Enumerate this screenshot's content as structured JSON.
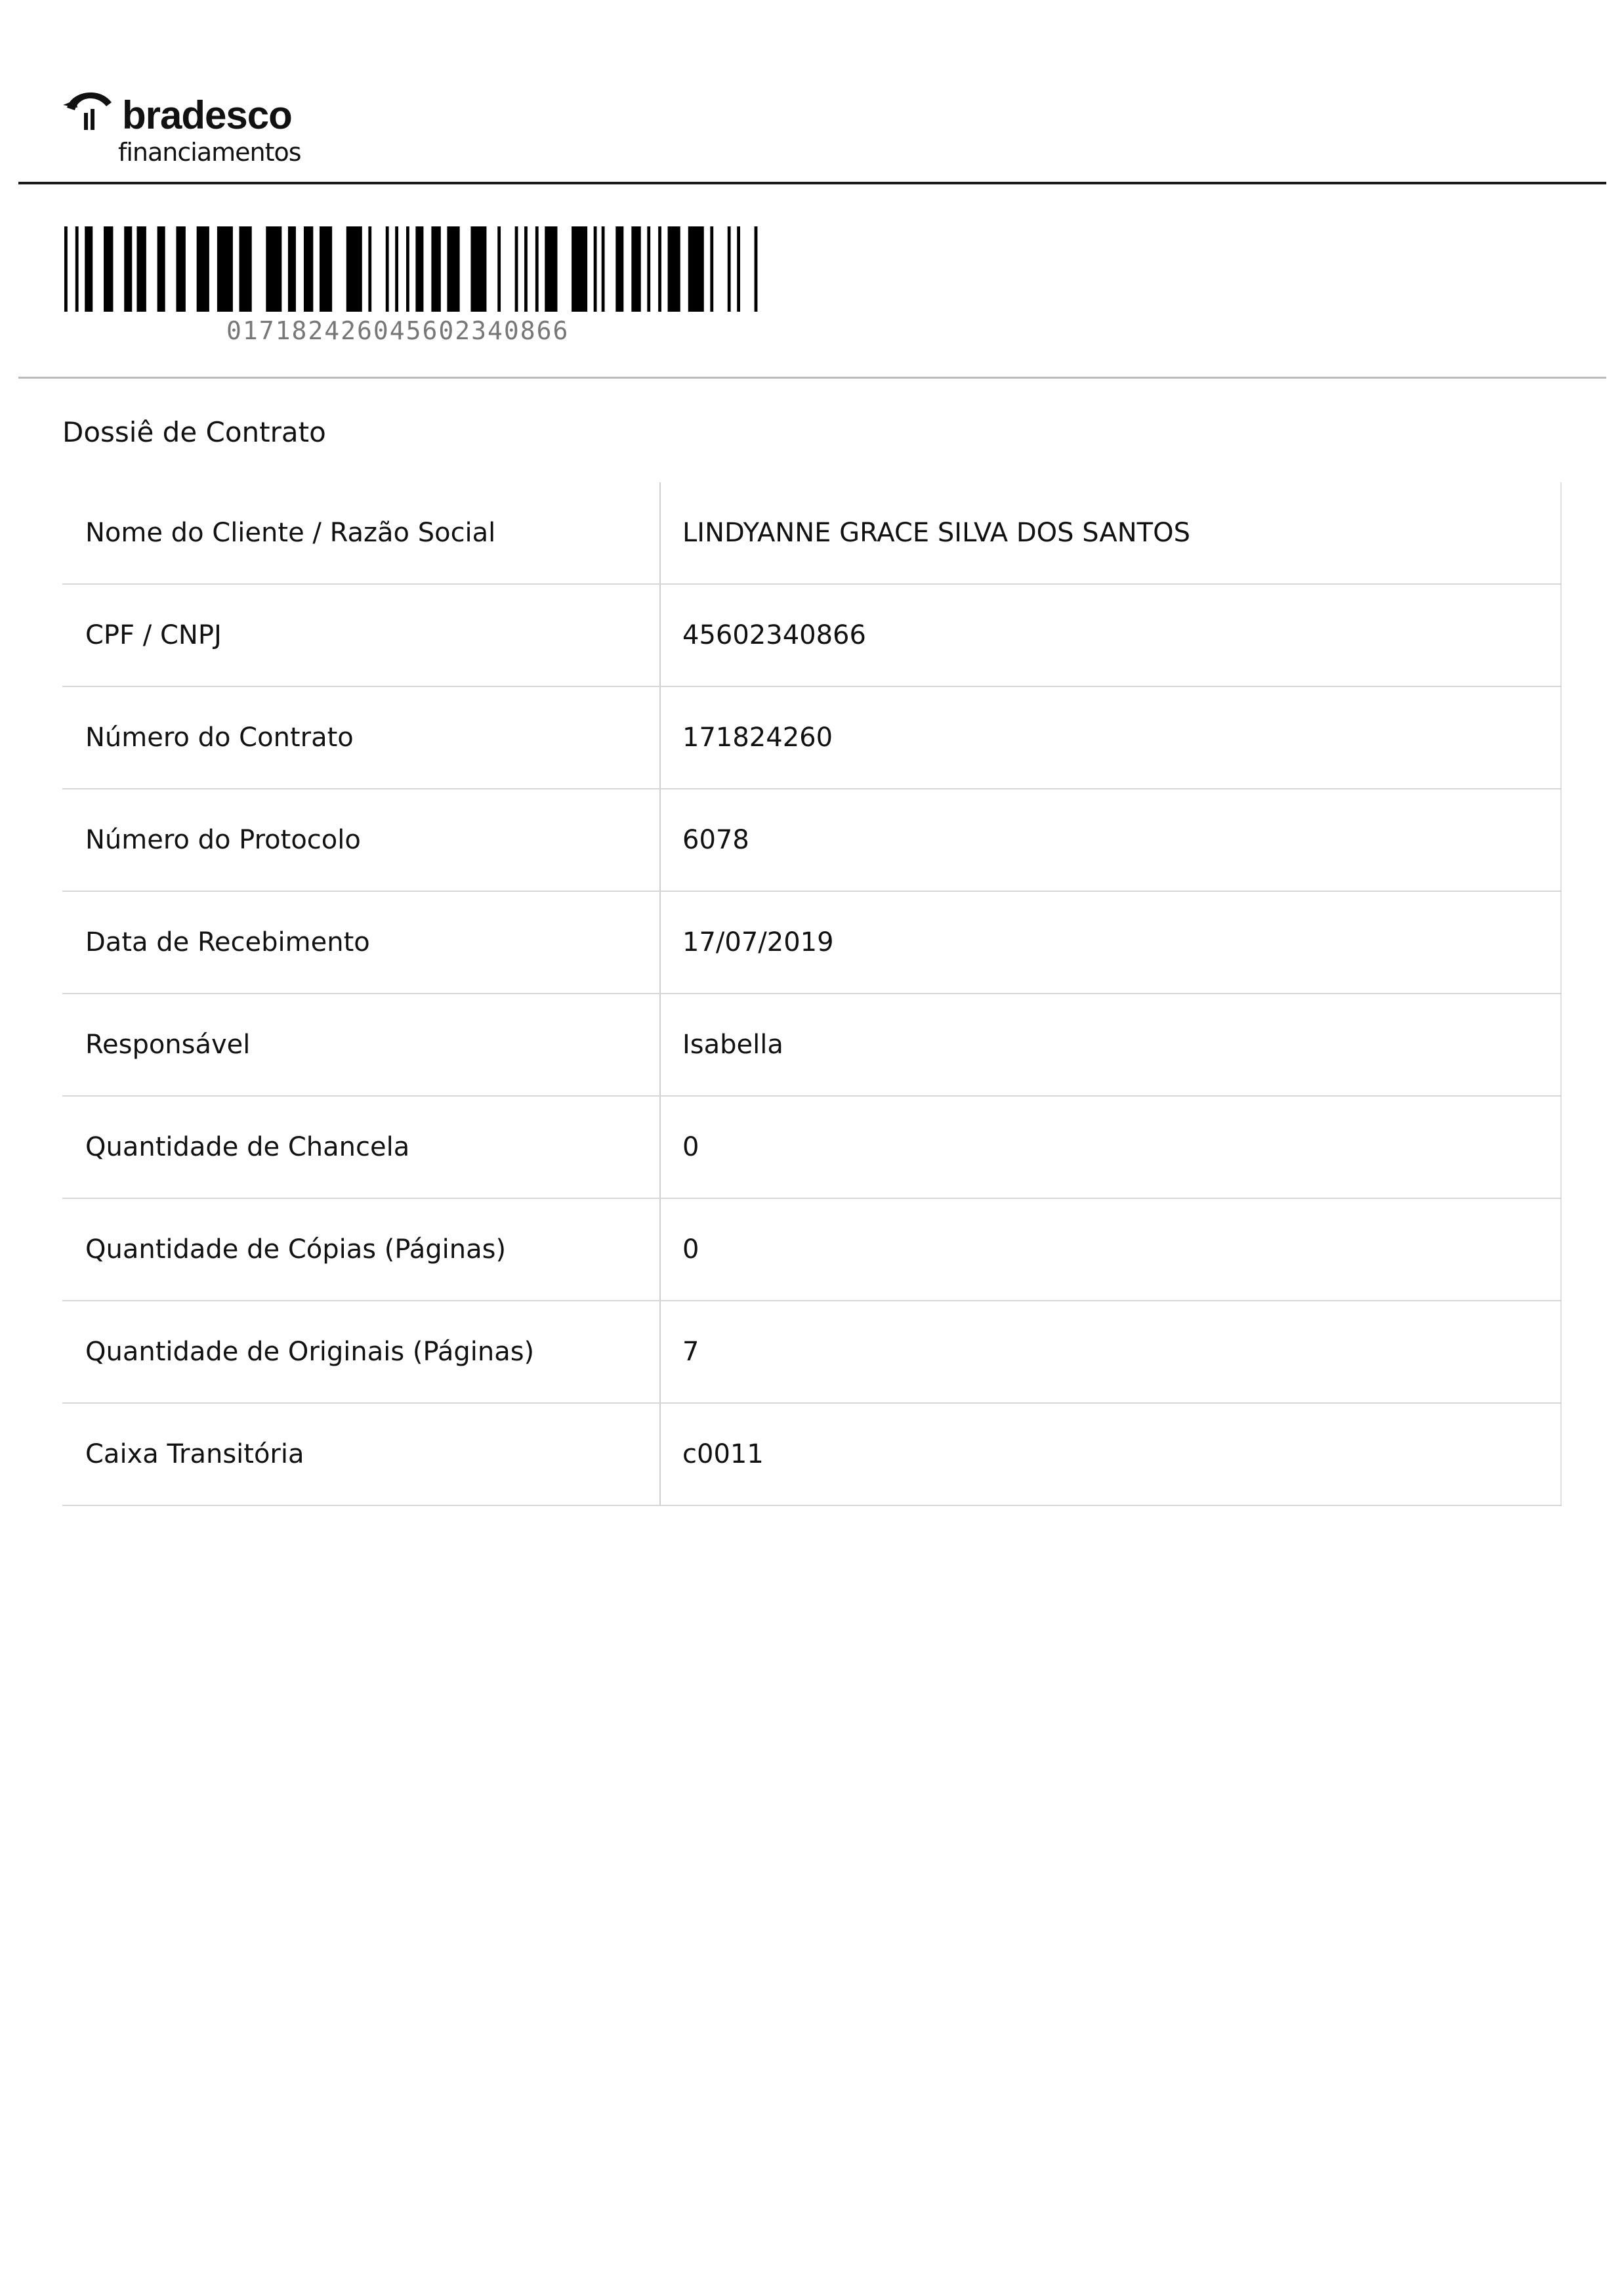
{
  "header": {
    "brand_name": "bradesco",
    "brand_sub": "financiamentos"
  },
  "barcode": {
    "text": "017182426045602340866"
  },
  "title": "Dossiê de Contrato",
  "rows": [
    {
      "label": "Nome do Cliente / Razão Social",
      "value": "LINDYANNE GRACE SILVA DOS SANTOS"
    },
    {
      "label": "CPF / CNPJ",
      "value": "45602340866"
    },
    {
      "label": "Número do Contrato",
      "value": "171824260"
    },
    {
      "label": "Número do Protocolo",
      "value": "6078"
    },
    {
      "label": "Data de Recebimento",
      "value": "17/07/2019"
    },
    {
      "label": "Responsável",
      "value": "Isabella"
    },
    {
      "label": "Quantidade de Chancela",
      "value": "0"
    },
    {
      "label": "Quantidade de Cópias (Páginas)",
      "value": "0"
    },
    {
      "label": "Quantidade de Originais (Páginas)",
      "value": "7"
    },
    {
      "label": "Caixa Transitória",
      "value": "c0011"
    }
  ]
}
